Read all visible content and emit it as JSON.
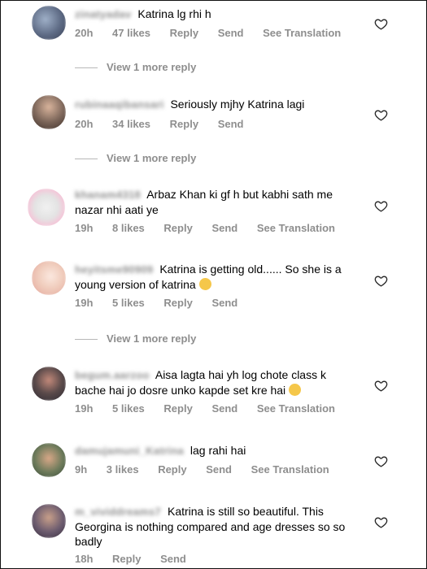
{
  "comments": [
    {
      "username": "zinatyadav",
      "text": "Katrina lg rhi h",
      "time": "20h",
      "likes": "47 likes",
      "reply": "Reply",
      "send": "Send",
      "translation": "See Translation",
      "avatar_color": "#5d6a84"
    },
    {
      "username": "rubinaaqibansari",
      "text": "Seriously mjhy Katrina lagi",
      "time": "20h",
      "likes": "34 likes",
      "reply": "Reply",
      "send": "Send",
      "translation": "",
      "avatar_color": "#7a6458"
    },
    {
      "username": "khanam4318",
      "text": "Arbaz Khan ki gf h but kabhi sath me nazar nhi aati ye",
      "time": "19h",
      "likes": "8 likes",
      "reply": "Reply",
      "send": "Send",
      "translation": "See Translation",
      "avatar_color": "#dcdcdc"
    },
    {
      "username": "heyitsme90909",
      "text": "Katrina is getting old...... So she is a young version of katrina",
      "time": "19h",
      "likes": "5 likes",
      "reply": "Reply",
      "send": "Send",
      "translation": "",
      "avatar_color": "#f0cdbd"
    },
    {
      "username": "begum.aarzoo",
      "text": "Aisa lagta hai yh log chote class k bache hai jo dosre unko kapde set kre hai",
      "time": "19h",
      "likes": "5 likes",
      "reply": "Reply",
      "send": "Send",
      "translation": "See Translation",
      "avatar_color": "#5a4a4a"
    },
    {
      "username": "damujamuni_Katrina",
      "text": "lag rahi hai",
      "time": "9h",
      "likes": "3 likes",
      "reply": "Reply",
      "send": "Send",
      "translation": "See Translation",
      "avatar_color": "#6c7a5a"
    },
    {
      "username": "m_vividdreams7",
      "text": "Katrina is still so beautiful. This Georgina is nothing compared and age dresses so so badly",
      "time": "18h",
      "likes": "",
      "reply": "Reply",
      "send": "Send",
      "translation": "",
      "avatar_color": "#6a5a6e"
    }
  ],
  "view_more_label": "View 1 more reply",
  "emoji_names": [
    "grin-emoji",
    "laughing-tears-emoji"
  ]
}
